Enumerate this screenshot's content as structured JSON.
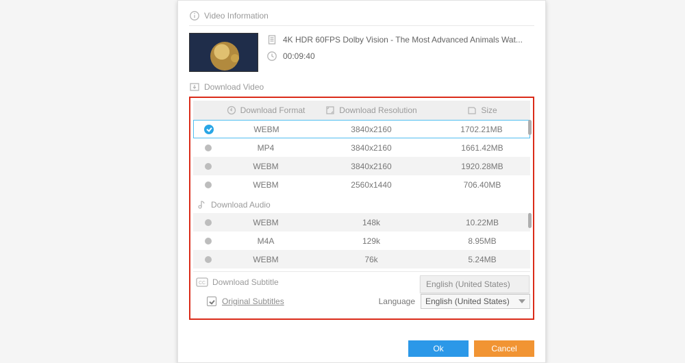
{
  "sections": {
    "videoInfo": "Video Information",
    "downloadVideo": "Download Video",
    "downloadAudio": "Download Audio",
    "downloadSubtitle": "Download Subtitle"
  },
  "video": {
    "title": "4K HDR 60FPS Dolby Vision - The Most Advanced Animals Wat...",
    "duration": "00:09:40"
  },
  "columns": {
    "format": "Download Format",
    "resolution": "Download Resolution",
    "size": "Size"
  },
  "videoRows": [
    {
      "format": "WEBM",
      "resolution": "3840x2160",
      "size": "1702.21MB",
      "selected": true
    },
    {
      "format": "MP4",
      "resolution": "3840x2160",
      "size": "1661.42MB",
      "selected": false
    },
    {
      "format": "WEBM",
      "resolution": "3840x2160",
      "size": "1920.28MB",
      "selected": false
    },
    {
      "format": "WEBM",
      "resolution": "2560x1440",
      "size": "706.40MB",
      "selected": false
    }
  ],
  "audioRows": [
    {
      "format": "WEBM",
      "bitrate": "148k",
      "size": "10.22MB"
    },
    {
      "format": "M4A",
      "bitrate": "129k",
      "size": "8.95MB"
    },
    {
      "format": "WEBM",
      "bitrate": "76k",
      "size": "5.24MB"
    }
  ],
  "subtitle": {
    "originalLabel": "Original Subtitles",
    "languageLabel": "Language",
    "selected": "English (United States)",
    "popup": "English (United States)"
  },
  "buttons": {
    "ok": "Ok",
    "cancel": "Cancel"
  }
}
